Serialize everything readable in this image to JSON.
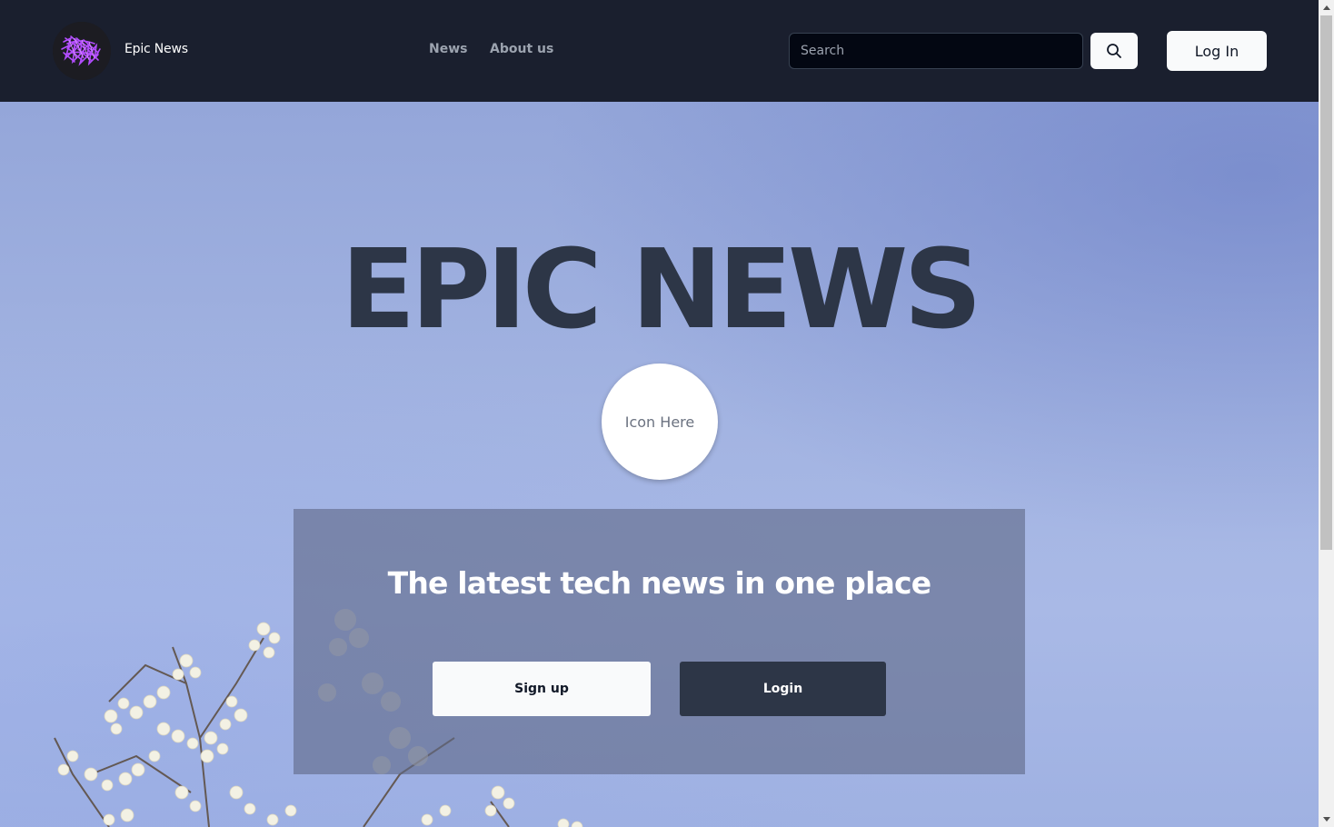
{
  "header": {
    "brand_name": "Epic News",
    "nav": [
      {
        "label": "News"
      },
      {
        "label": "About us"
      }
    ],
    "search": {
      "placeholder": "Search",
      "value": ""
    },
    "login_label": "Log In"
  },
  "hero": {
    "title": "EPIC NEWS",
    "icon_placeholder": "Icon Here",
    "panel": {
      "heading": "The latest tech news in one place",
      "signup_label": "Sign up",
      "login_label": "Login"
    }
  },
  "colors": {
    "header_bg": "#1a1f2e",
    "hero_sky": "#a3b4e2",
    "title": "#2d3647",
    "panel_bg": "rgba(95,105,135,0.62)",
    "dark_button": "#2d3647",
    "logo_accent": "#b34dff"
  },
  "icons": {
    "logo": "purple-scribble-logo",
    "search_button": "magnifier-icon",
    "scroll_up": "triangle-up-icon",
    "scroll_down": "triangle-down-icon"
  }
}
